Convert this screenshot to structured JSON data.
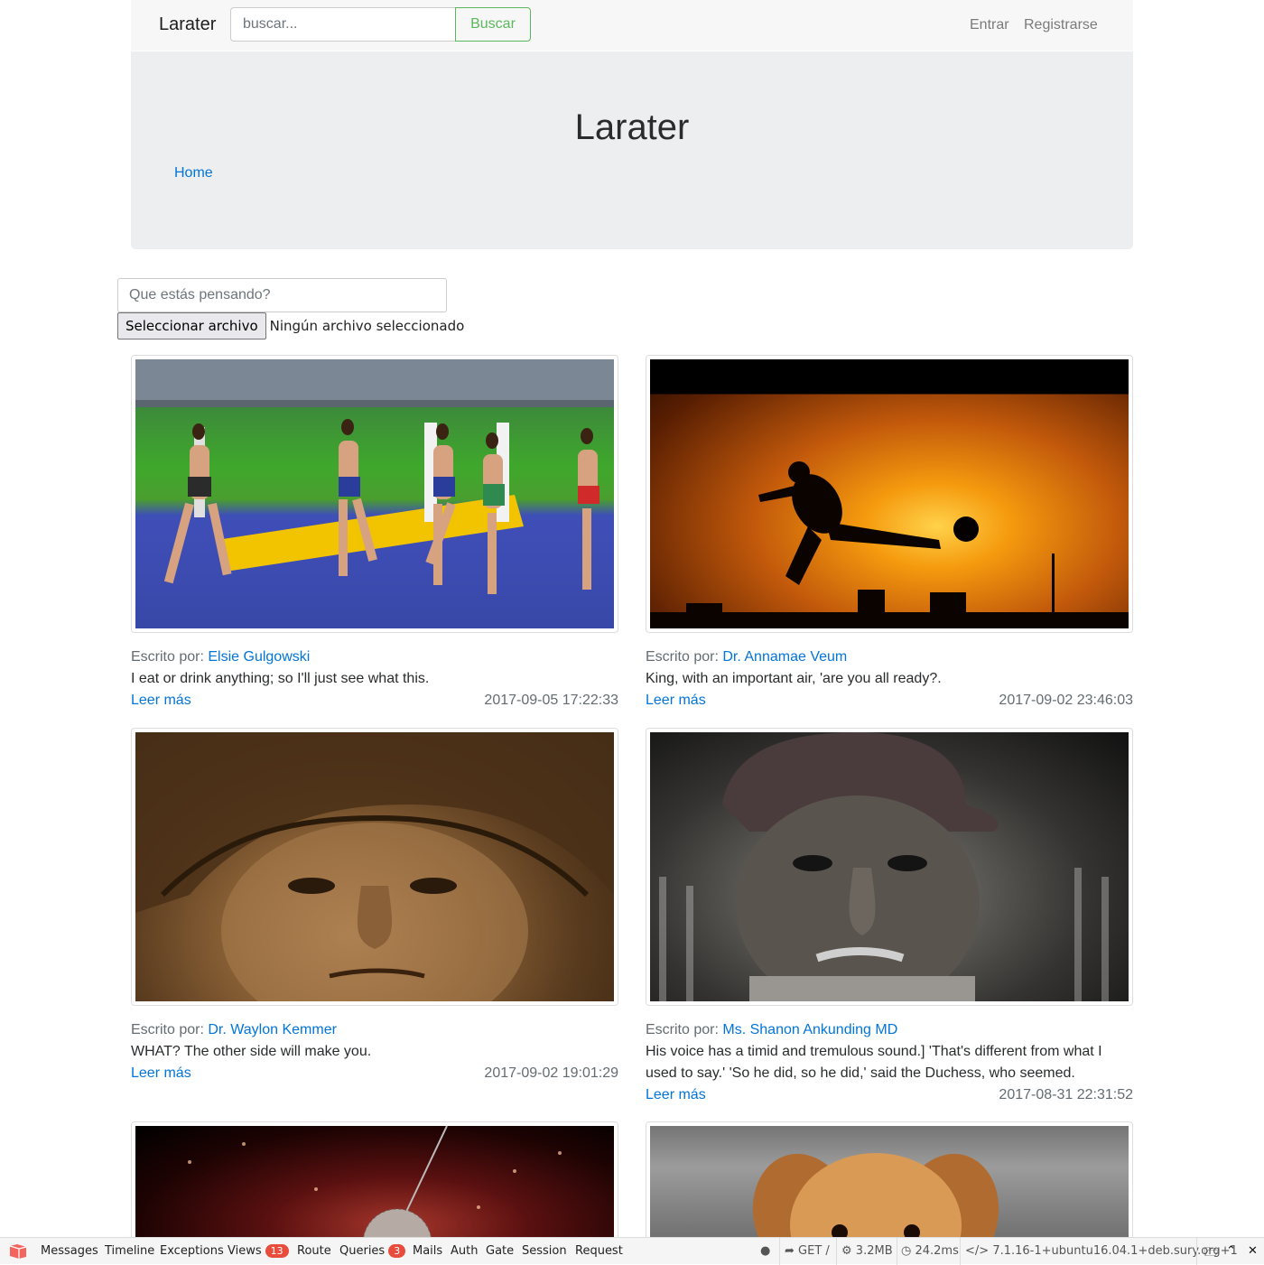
{
  "navbar": {
    "brand": "Larater",
    "search_placeholder": "buscar...",
    "search_button": "Buscar",
    "login": "Entrar",
    "register": "Registrarse"
  },
  "jumbotron": {
    "title": "Larater",
    "breadcrumb": "Home"
  },
  "composer": {
    "placeholder": "Que estás pensando?",
    "file_button": "Seleccionar archivo",
    "file_status": "Ningún archivo seleccionado"
  },
  "post_meta_label": "Escrito por:",
  "read_more": "Leer más",
  "posts": [
    {
      "author": "Elsie Gulgowski",
      "excerpt": "I eat or drink anything; so I'll just see what this.",
      "date": "2017-09-05 17:22:33",
      "image": "track-runners"
    },
    {
      "author": "Dr. Annamae Veum",
      "excerpt": "King, with an important air, 'are you all ready?.",
      "date": "2017-09-02 23:46:03",
      "image": "sunset-kick"
    },
    {
      "author": "Dr. Waylon Kemmer",
      "excerpt": "WHAT? The other side will make you.",
      "date": "2017-09-02 19:01:29",
      "image": "old-woman-hat"
    },
    {
      "author": "Ms. Shanon Ankunding MD",
      "excerpt": "His voice has a timid and tremulous sound.] 'That's different from what I used to say.' 'So he did, so he did,' said the Duchess, who seemed.",
      "date": "2017-08-31 22:31:52",
      "image": "old-man-cap"
    },
    {
      "image": "disco-ball"
    },
    {
      "image": "puppy"
    }
  ],
  "debugbar": {
    "tabs": [
      "Messages",
      "Timeline",
      "Exceptions",
      "Views",
      "Route",
      "Queries",
      "Mails",
      "Auth",
      "Gate",
      "Session",
      "Request"
    ],
    "views_count": "13",
    "queries_count": "3",
    "method_route": "GET /",
    "memory": "3.2MB",
    "duration": "24.2ms",
    "php_version": "7.1.16-1+ubuntu16.04.1+deb.sury.org+1",
    "accent": "#e74c3c"
  }
}
